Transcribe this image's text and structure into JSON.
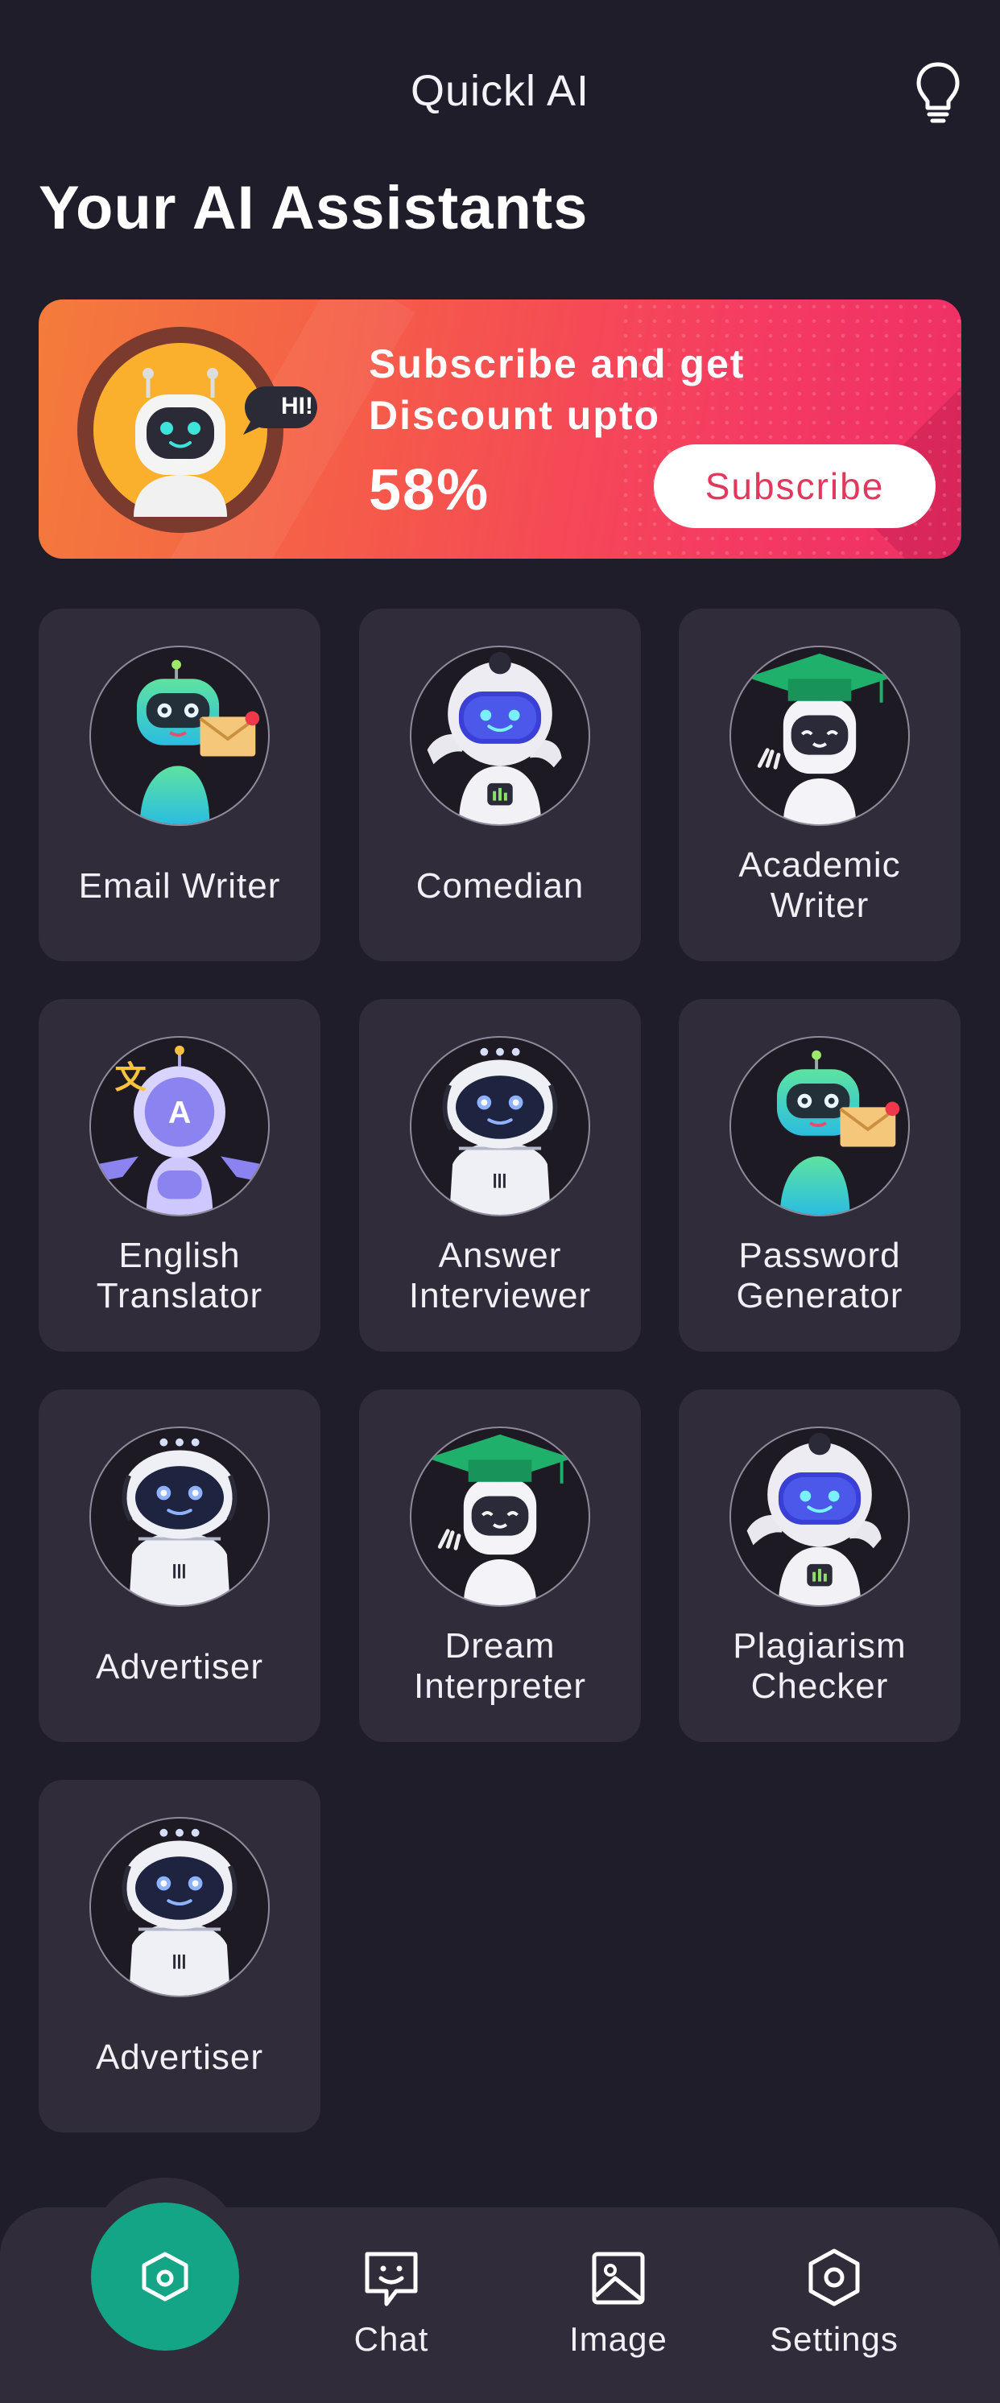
{
  "header": {
    "app_title": "Quickl AI",
    "tip_icon": "lightbulb-icon"
  },
  "page_title": "Your AI Assistants",
  "banner": {
    "headline_line1": "Subscribe and get",
    "headline_line2": "Discount upto",
    "percent": "58%",
    "bubble": "HI!",
    "button_label": "Subscribe",
    "colors": {
      "start": "#f47c3b",
      "end": "#ee2e66",
      "button_text": "#e2385e"
    }
  },
  "assistants": [
    {
      "line1": "Email Writer",
      "line2": "",
      "robot": "green-mail-robot"
    },
    {
      "line1": "Comedian",
      "line2": "",
      "robot": "visor-robot"
    },
    {
      "line1": "Academic",
      "line2": "Writer",
      "robot": "graduate-robot"
    },
    {
      "line1": "English",
      "line2": "Translator",
      "robot": "translator-robot"
    },
    {
      "line1": "Answer",
      "line2": "Interviewer",
      "robot": "round-robot"
    },
    {
      "line1": "Password",
      "line2": "Generator",
      "robot": "green-mail-robot"
    },
    {
      "line1": "Advertiser",
      "line2": "",
      "robot": "round-robot"
    },
    {
      "line1": "Dream",
      "line2": "Interpreter",
      "robot": "graduate-robot"
    },
    {
      "line1": "Plagiarism",
      "line2": "Checker",
      "robot": "visor-robot"
    },
    {
      "line1": "Advertiser",
      "line2": "",
      "robot": "round-robot"
    }
  ],
  "nav": {
    "home_icon": "home-icon",
    "items": [
      {
        "label": "Chat",
        "icon": "chat-icon"
      },
      {
        "label": "Image",
        "icon": "image-icon"
      },
      {
        "label": "Settings",
        "icon": "settings-icon"
      }
    ],
    "accent": "#13a586"
  }
}
